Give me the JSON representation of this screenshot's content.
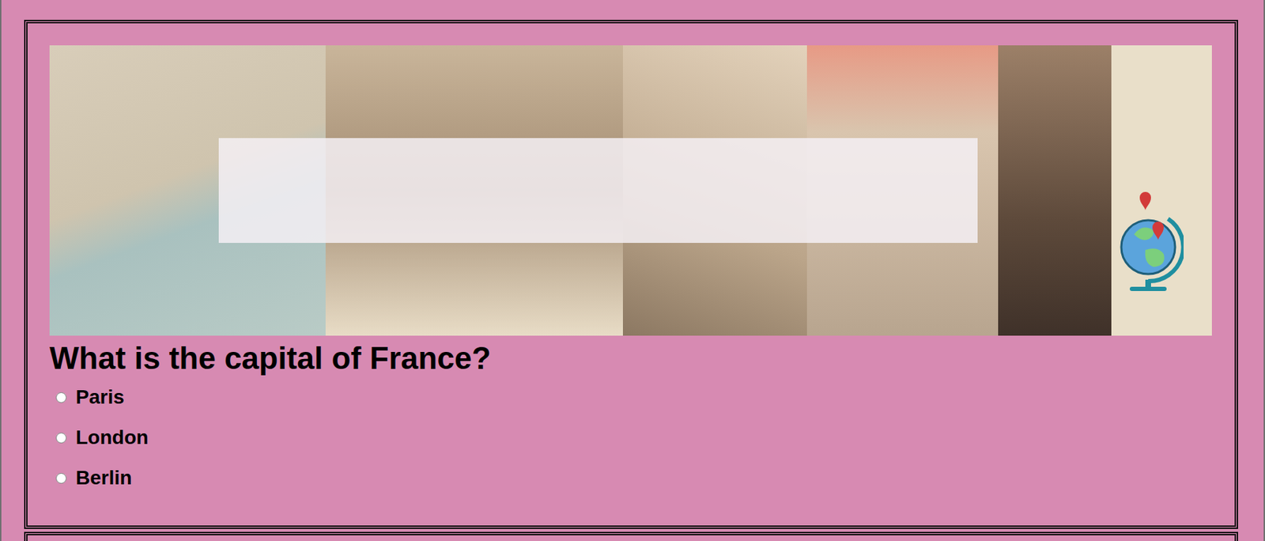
{
  "quiz": {
    "questions": [
      {
        "text": "What is the capital of France?",
        "options": [
          {
            "label": "Paris",
            "selected": false
          },
          {
            "label": "London",
            "selected": false
          },
          {
            "label": "Berlin",
            "selected": false
          }
        ]
      }
    ]
  }
}
